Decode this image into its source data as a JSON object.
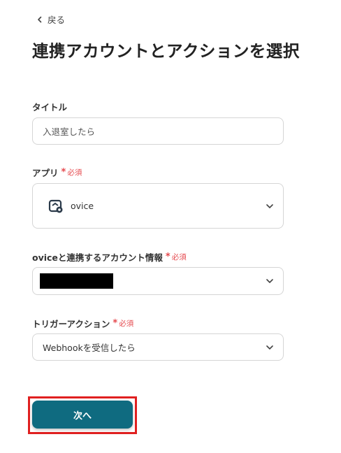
{
  "header": {
    "back_label": "戻る",
    "title": "連携アカウントとアクションを選択"
  },
  "form": {
    "required_label": "必須",
    "title_field": {
      "label": "タイトル",
      "value": "入退室したら"
    },
    "app_field": {
      "label": "アプリ",
      "value": "ovice",
      "icon": "ovice-app-icon"
    },
    "account_field": {
      "label": "oviceと連携するアカウント情報",
      "value_redacted": true
    },
    "trigger_field": {
      "label": "トリガーアクション",
      "value": "Webhookを受信したら"
    }
  },
  "footer": {
    "next_label": "次へ"
  },
  "colors": {
    "primary": "#0f6b80",
    "required": "#e5484d",
    "highlight": "#e02020",
    "border": "#d5d5d5"
  }
}
